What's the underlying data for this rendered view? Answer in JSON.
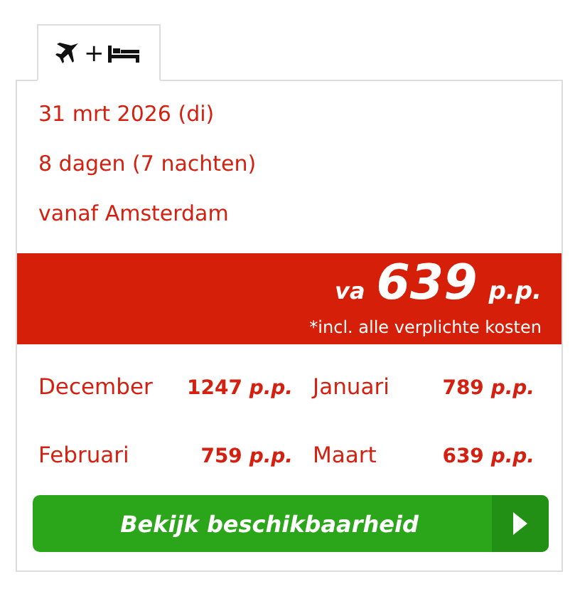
{
  "tabs": [
    {
      "label": "+",
      "selected": true
    }
  ],
  "details": [
    "31 mrt 2026 (di)",
    "8 dagen (7 nachten)",
    "vanaf Amsterdam"
  ],
  "price_band": {
    "prefix": "va",
    "amount": "639",
    "unit": "p.p.",
    "note": "*incl. alle verplichte kosten"
  },
  "months": [
    {
      "name": "December",
      "price": "1247 *p.p.*"
    },
    {
      "name": "Januari",
      "price": "789 *p.p.*"
    },
    {
      "name": "Februari",
      "price": "759 *p.p.*"
    },
    {
      "name": "Maart",
      "price": "639 *p.p.*"
    }
  ],
  "button": {
    "label": "Bekijk beschikbaarheid"
  }
}
